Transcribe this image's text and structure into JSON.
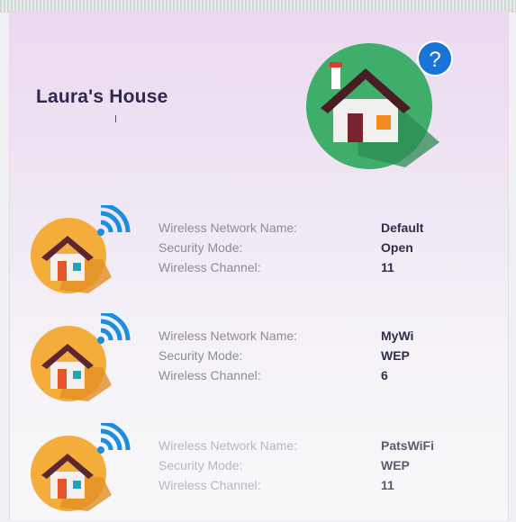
{
  "house_title": "Laura's House",
  "help_label": "?",
  "field_labels": {
    "name": "Wireless Network Name:",
    "security": "Security Mode:",
    "channel": "Wireless Channel:"
  },
  "networks": [
    {
      "name": "Default",
      "security": "Open",
      "channel": "11"
    },
    {
      "name": "MyWi",
      "security": "WEP",
      "channel": "6"
    },
    {
      "name": "PatsWiFi",
      "security": "WEP",
      "channel": "11"
    }
  ],
  "icons": {
    "hero": "house-icon",
    "help": "help-icon",
    "network": "wifi-house-icon"
  },
  "colors": {
    "hero_circle": "#3fae6a",
    "help_badge": "#1a73d6",
    "network_circle": "#f4ad3a",
    "wifi_arcs": "#1b8ee0",
    "roof": "#5a2733"
  }
}
